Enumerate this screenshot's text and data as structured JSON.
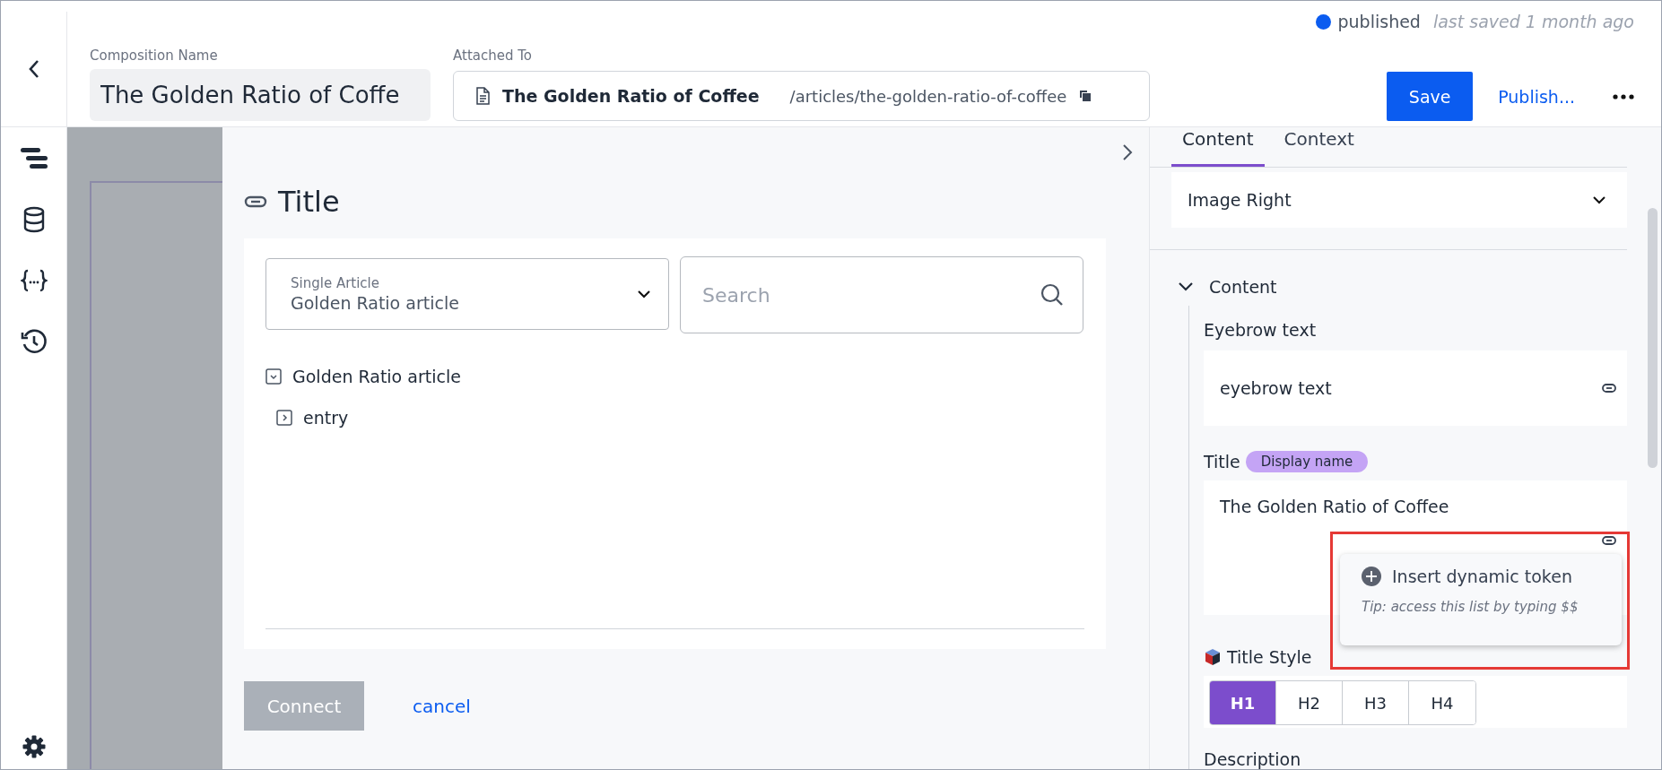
{
  "header": {
    "composition_label": "Composition Name",
    "composition_name": "The Golden Ratio of Coffe",
    "attached_label": "Attached To",
    "attached_title": "The Golden Ratio of Coffee",
    "attached_path": "/articles/the-golden-ratio-of-coffee",
    "status": "published",
    "last_saved": "last saved 1 month ago",
    "save": "Save",
    "publish": "Publish..."
  },
  "modal": {
    "title": "Title",
    "source_label": "Single Article",
    "source_value": "Golden Ratio article",
    "search_placeholder": "Search",
    "tree": [
      {
        "label": "Golden Ratio article",
        "expanded": true,
        "children": [
          {
            "label": "entry",
            "expanded": false
          }
        ]
      }
    ],
    "connect": "Connect",
    "connect_disabled": true,
    "cancel": "cancel"
  },
  "panel": {
    "tabs": [
      {
        "label": "Content",
        "selected": true
      },
      {
        "label": "Context",
        "selected": false
      }
    ],
    "variant": "Image Right",
    "section": "Content",
    "section_expanded": true,
    "eyebrow_label": "Eyebrow text",
    "eyebrow_value": "eyebrow text",
    "title_label": "Title",
    "title_badge": "Display name",
    "title_value": "The Golden Ratio of Coffee",
    "popup": {
      "item": "Insert dynamic token",
      "tip": "Tip: access this list by typing $$"
    },
    "style_label": "Title Style",
    "styles": [
      {
        "label": "H1",
        "selected": true
      },
      {
        "label": "H2",
        "selected": false
      },
      {
        "label": "H3",
        "selected": false
      },
      {
        "label": "H4",
        "selected": false
      }
    ],
    "description_label": "Description"
  }
}
